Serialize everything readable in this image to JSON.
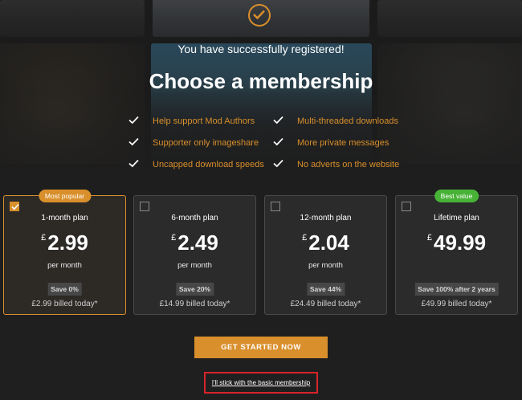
{
  "header": {
    "success_text": "You have successfully registered!",
    "title": "Choose a membership",
    "success_icon": "check-circle-icon",
    "accent": "#d98f2b"
  },
  "benefits": [
    {
      "label": "Help support Mod Authors"
    },
    {
      "label": "Multi-threaded downloads"
    },
    {
      "label": "Supporter only imageshare"
    },
    {
      "label": "More private messages"
    },
    {
      "label": "Uncapped download speeds"
    },
    {
      "label": "No adverts on the website"
    }
  ],
  "plans": [
    {
      "name": "1-month plan",
      "currency": "£",
      "price": "2.99",
      "per": "per month",
      "save": "Save 0%",
      "billed": "£2.99 billed today*",
      "badge": "Most popular",
      "selected": true
    },
    {
      "name": "6-month plan",
      "currency": "£",
      "price": "2.49",
      "per": "per month",
      "save": "Save 20%",
      "billed": "£14.99 billed today*",
      "badge": "",
      "selected": false
    },
    {
      "name": "12-month plan",
      "currency": "£",
      "price": "2.04",
      "per": "per month",
      "save": "Save 44%",
      "billed": "£24.49 billed today*",
      "badge": "",
      "selected": false
    },
    {
      "name": "Lifetime plan",
      "currency": "£",
      "price": "49.99",
      "per": "",
      "save": "Save 100% after 2 years",
      "billed": "£49.99 billed today*",
      "badge": "Best value",
      "selected": false
    }
  ],
  "cta": {
    "label": "GET STARTED NOW"
  },
  "basic": {
    "label": "I'll stick with the basic membership",
    "highlight": "#d8232a"
  },
  "colors": {
    "popular_badge": "#d98f2b",
    "value_badge": "#47b236"
  }
}
